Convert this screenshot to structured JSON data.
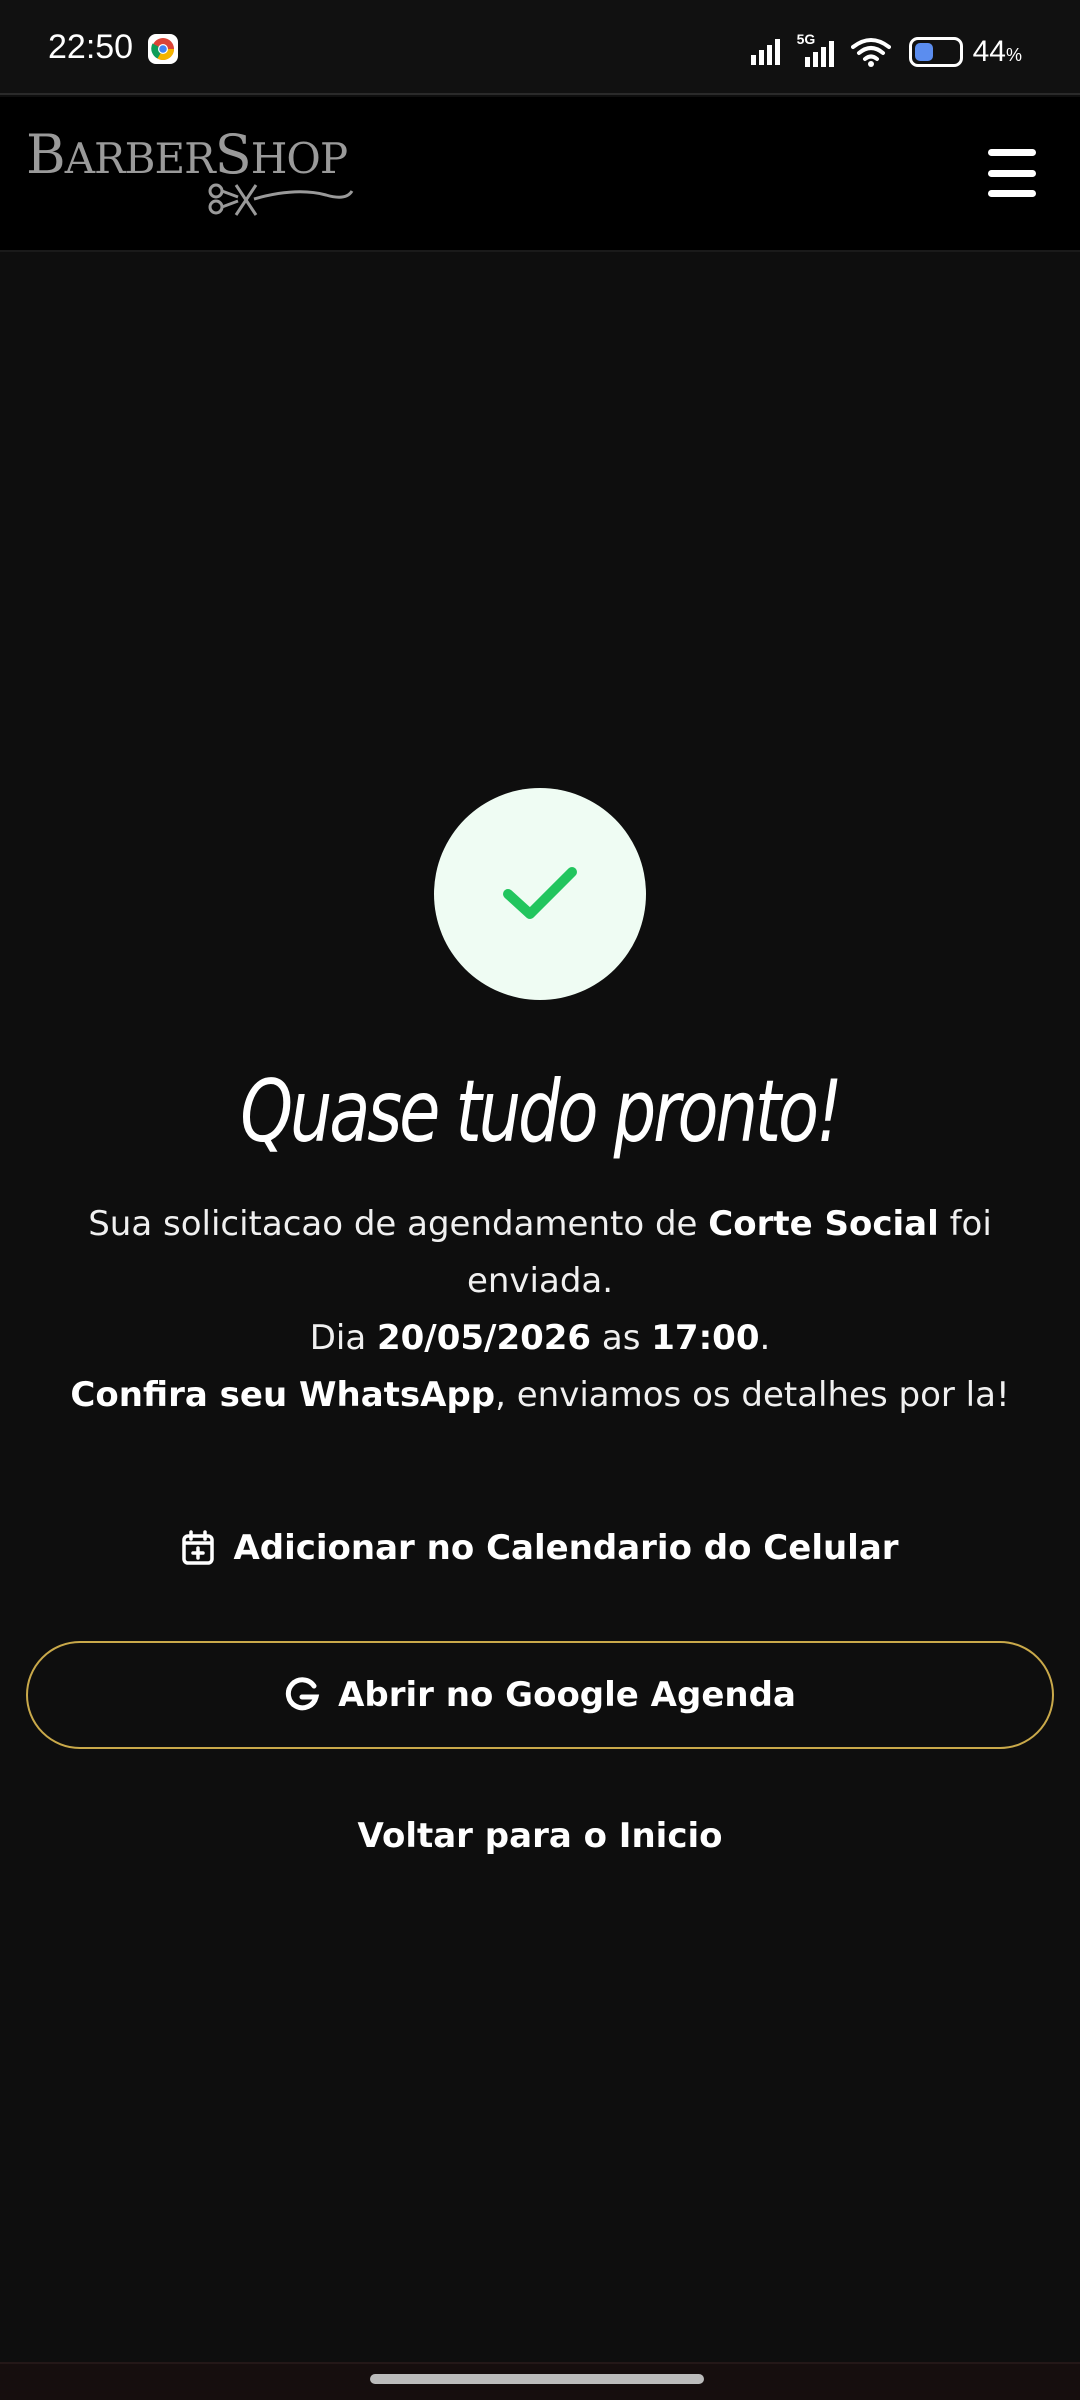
{
  "status_bar": {
    "time": "22:50",
    "app_icon": "chrome-icon",
    "network_label": "5G",
    "battery_percent": "44",
    "battery_unit": "%",
    "battery_level": 0.44
  },
  "header": {
    "logo_text_big_b": "B",
    "logo_text_arber": "ARBER",
    "logo_text_big_s": "S",
    "logo_text_hop": "HOP",
    "menu_icon": "hamburger-menu-icon"
  },
  "success": {
    "icon": "checkmark-icon",
    "title": "Quase tudo pronto!",
    "message": {
      "part1": "Sua solicitacao de agendamento de ",
      "service": "Corte Social",
      "part2": " foi enviada.",
      "day_prefix": "Dia ",
      "date": "20/05/2026",
      "time_prefix": " as ",
      "time": "17:00",
      "period": ".",
      "whatsapp_bold": "Confira seu WhatsApp",
      "whatsapp_rest": ", enviamos os detalhes por la!"
    }
  },
  "actions": {
    "calendar_label": "Adicionar no Calendario do Celular",
    "google_label": "Abrir no Google Agenda",
    "back_label": "Voltar para o Inicio"
  },
  "colors": {
    "background": "#0e0e0e",
    "success_green": "#22c55e",
    "success_bg": "#effcf3",
    "accent_gold": "#c9a94a"
  }
}
